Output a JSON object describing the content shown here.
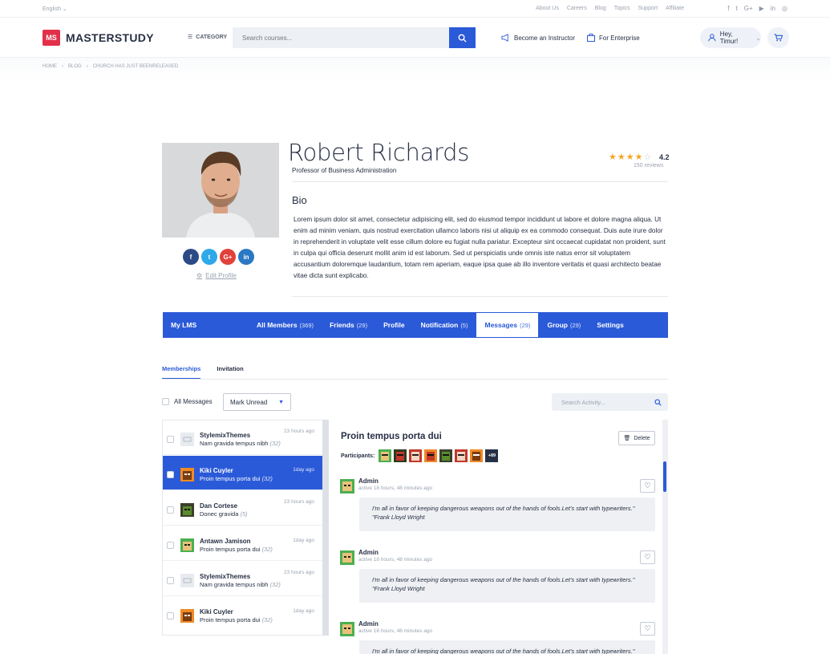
{
  "topbar": {
    "language": "English",
    "links": [
      "About Us",
      "Careers",
      "Blog",
      "Topics",
      "Support",
      "Affiliate"
    ],
    "social_icons": [
      "facebook-icon",
      "twitter-icon",
      "google-plus-icon",
      "youtube-icon",
      "linkedin-icon",
      "instagram-icon"
    ]
  },
  "header": {
    "logo_mark": "MS",
    "logo_text": "MASTERSTUDY",
    "category_label": "CATEGORY",
    "search_placeholder": "Search courses...",
    "become_instructor": "Become an Instructor",
    "for_enterprise": "For Enterprise",
    "greeting": "Hey, Timur!"
  },
  "breadcrumb": [
    "HOME",
    "BLOG",
    "CHURCH HAS JUST BEENRELEASED"
  ],
  "profile": {
    "name": "Robert Richards",
    "title": "Professor of Business Administration",
    "rating": "4.2",
    "rating_value": 4.2,
    "reviews": "150 reviews",
    "bio_heading": "Bio",
    "bio_text": "Lorem ipsum dolor sit amet, consectetur adipisicing elit, sed do eiusmod tempor incididunt ut labore et dolore magna aliqua. Ut enim ad minim veniam, quis nostrud exercitation ullamco laboris nisi ut aliquip ex ea commodo consequat. Duis aute irure dolor in reprehenderit in voluptate velit esse cillum dolore eu fugiat nulla pariatur. Excepteur sint occaecat cupidatat non proident, sunt in culpa qui officia deserunt mollit anim id est laborum. Sed ut perspiciatis unde omnis iste natus error sit voluptatem accusantium doloremque laudantium, totam rem aperiam, eaque ipsa quae ab illo inventore veritatis et quasi architecto beatae vitae dicta sunt explicabo.",
    "edit_profile": "Edit Profile",
    "social": [
      {
        "label": "f",
        "color": "#3b5998"
      },
      {
        "label": "t",
        "color": "#1da1f2"
      },
      {
        "label": "G+",
        "color": "#dd4b39"
      },
      {
        "label": "in",
        "color": "#0077b5"
      }
    ]
  },
  "tabs": [
    {
      "label": "My LMS",
      "count": ""
    },
    {
      "label": "All Members",
      "count": "(369)"
    },
    {
      "label": "Friends",
      "count": "(29)"
    },
    {
      "label": "Profile",
      "count": ""
    },
    {
      "label": "Notification",
      "count": "(5)"
    },
    {
      "label": "Messages",
      "count": "(29)"
    },
    {
      "label": "Group",
      "count": "(29)"
    },
    {
      "label": "Settings",
      "count": ""
    }
  ],
  "subtabs": [
    "Memberships",
    "Invitation"
  ],
  "controls": {
    "all_messages": "All Messages",
    "mark_unread": "Mark Unread",
    "search_activity": "Search Activity..."
  },
  "conversations": [
    {
      "name": "StylemixThemes",
      "subject": "Nam gravida tempus nibh",
      "count": "(32)",
      "time": "23 hours ago"
    },
    {
      "name": "Kiki Cuyler",
      "subject": "Proin tempus porta dui",
      "count": "(32)",
      "time": "1day ago"
    },
    {
      "name": "Dan Cortese",
      "subject": "Donec gravida",
      "count": "(5)",
      "time": "23 hours ago"
    },
    {
      "name": "Antawn Jamison",
      "subject": "Proin tempus porta dui",
      "count": "(32)",
      "time": "1day ago"
    },
    {
      "name": "StylemixThemes",
      "subject": "Nam gravida tempus nibh",
      "count": "(32)",
      "time": "23 hours ago"
    },
    {
      "name": "Kiki Cuyler",
      "subject": "Proin tempus porta dui",
      "count": "(32)",
      "time": "1day ago"
    }
  ],
  "thread": {
    "title": "Proin tempus porta dui",
    "delete_label": "Delete",
    "participants_label": "Participants:",
    "participants_more": "+89",
    "messages": [
      {
        "author": "Admin",
        "time": "active 18 hours, 48 minutes ago",
        "text": "I'm all in favor of keeping dangerous weapons out of the hands of fools.Let's start with typewriters.\" \"Frank Lloyd Wright"
      },
      {
        "author": "Admin",
        "time": "active 18 hours, 48 minutes ago",
        "text": "I'm all in favor of keeping dangerous weapons out of the hands of fools.Let's start with typewriters.\" \"Frank Lloyd Wright"
      },
      {
        "author": "Admin",
        "time": "active 18 hours, 48 minutes ago",
        "text": "I'm all in favor of keeping dangerous weapons out of the hands of fools.Let's start with typewriters.\" \"Frank Lloyd Wright"
      }
    ]
  },
  "colors": {
    "accent": "#2b5ad8",
    "brand_red": "#e3304a",
    "star": "#f5a623"
  }
}
